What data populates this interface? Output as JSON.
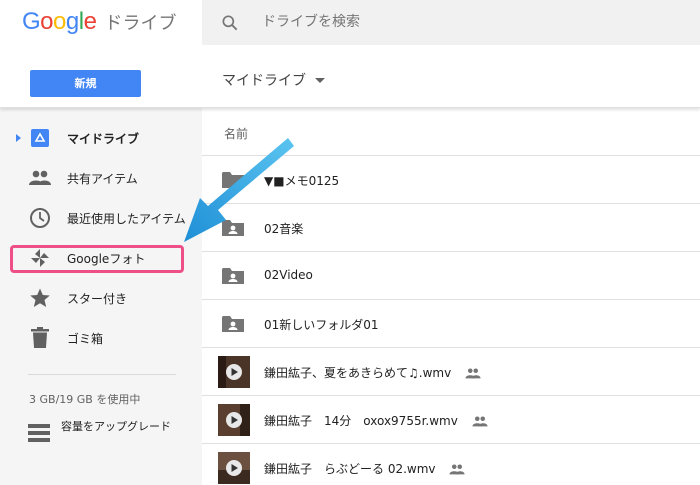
{
  "header": {
    "logo_text": "Google",
    "app_name": "ドライブ",
    "search_placeholder": "ドライブを検索"
  },
  "toolbar": {
    "new_label": "新規",
    "location_label": "マイドライブ"
  },
  "sidebar": {
    "items": [
      {
        "label": "マイドライブ",
        "icon": "drive-icon",
        "active": true
      },
      {
        "label": "共有アイテム",
        "icon": "people-icon"
      },
      {
        "label": "最近使用したアイテム",
        "icon": "clock-icon"
      },
      {
        "label": "Googleフォト",
        "icon": "photos-icon",
        "highlighted": true
      },
      {
        "label": "スター付き",
        "icon": "star-icon"
      },
      {
        "label": "ゴミ箱",
        "icon": "trash-icon"
      }
    ],
    "storage_text": "3 GB/19 GB を使用中",
    "upgrade_label": "容量をアップグレード"
  },
  "file_list": {
    "column_name": "名前",
    "rows": [
      {
        "name": "▼■メモ0125",
        "type": "folder",
        "icon": "folder-icon"
      },
      {
        "name": "02音楽",
        "type": "shared-folder",
        "icon": "shared-folder-icon"
      },
      {
        "name": "02Video",
        "type": "shared-folder",
        "icon": "shared-folder-icon"
      },
      {
        "name": "01新しいフォルダ01",
        "type": "shared-folder",
        "icon": "shared-folder-icon"
      },
      {
        "name": "鎌田紘子、夏をあきらめて♫.wmv",
        "type": "video",
        "shared": true
      },
      {
        "name": "鎌田紘子　14分　oxox9755r.wmv",
        "type": "video",
        "shared": true
      },
      {
        "name": "鎌田紘子　らぶどーる 02.wmv",
        "type": "video",
        "shared": true
      }
    ]
  },
  "colors": {
    "accent": "#4285f4",
    "highlight": "#ee4f87",
    "annotation_arrow": "#2aa3e3",
    "sidebar_bg": "#f5f5f5"
  }
}
